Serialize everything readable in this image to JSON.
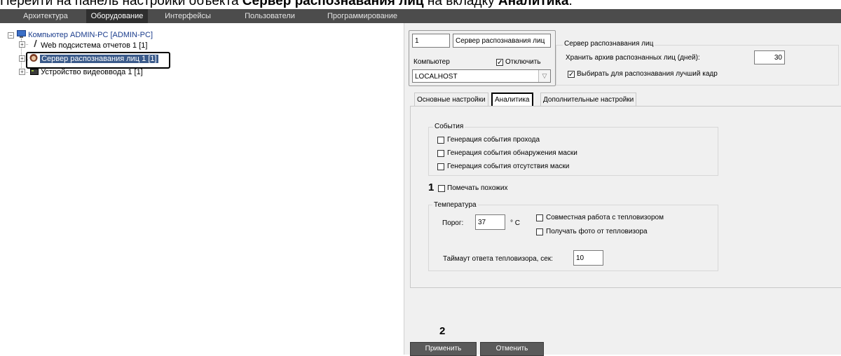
{
  "caption": {
    "prefix": "Перейти на панель настройки объекта ",
    "bold_object": "Сервер распознавания лиц",
    "middle": " на вкладку ",
    "bold_tab": "Аналитика",
    "suffix": "."
  },
  "menubar": {
    "tabs": [
      "Архитектура",
      "Оборудование",
      "Интерфейсы",
      "Пользователи",
      "Программирование"
    ],
    "active_index": 1
  },
  "tree": {
    "root": "Компьютер ADMIN-PC [ADMIN-PC]",
    "children": [
      "Web подсистема отчетов 1 [1]",
      "Сервер распознавания лиц 1 [1]",
      "Устройство видеоввода 1 [1]"
    ],
    "selected_index": 1
  },
  "object": {
    "id": "1",
    "name": "Сервер распознавания лиц",
    "computer_label": "Компьютер",
    "disable_label": "Отключить",
    "disable_checked": true,
    "computer_value": "LOCALHOST"
  },
  "server_group": {
    "title": "Сервер распознавания лиц",
    "archive_label": "Хранить архив распознанных лиц (дней):",
    "archive_days": "30",
    "best_frame_label": "Выбирать для распознавания лучший кадр",
    "best_frame_checked": true
  },
  "tabs": [
    "Основные настройки",
    "Аналитика",
    "Дополнительные настройки"
  ],
  "active_tab_index": 1,
  "events_group": {
    "title": "События",
    "items": [
      {
        "label": "Генерация события прохода",
        "checked": false
      },
      {
        "label": "Генерация события обнаружения маски",
        "checked": false
      },
      {
        "label": "Генерация события отсутствия маски",
        "checked": false
      }
    ]
  },
  "mark_similar": {
    "label": "Помечать похожих",
    "checked": false,
    "marker": "1"
  },
  "temperature_group": {
    "title": "Температура",
    "threshold_label": "Порог:",
    "threshold_value": "37",
    "unit": "° C",
    "thermal_joint_label": "Совместная работа с тепловизором",
    "thermal_joint_checked": false,
    "thermal_photo_label": "Получать фото от тепловизора",
    "thermal_photo_checked": false,
    "timeout_label": "Таймаут ответа тепловизора, сек:",
    "timeout_value": "10"
  },
  "buttons": {
    "apply": "Применить",
    "cancel": "Отменить",
    "marker": "2"
  },
  "colors": {
    "menubar": "#4c4c4c",
    "menubar_active": "#2f2f2f",
    "panel": "#f0f0f0",
    "tree_link": "#1a3c8c",
    "selected_text": "#ffffff",
    "selected_bg": "#3a5a8a"
  }
}
